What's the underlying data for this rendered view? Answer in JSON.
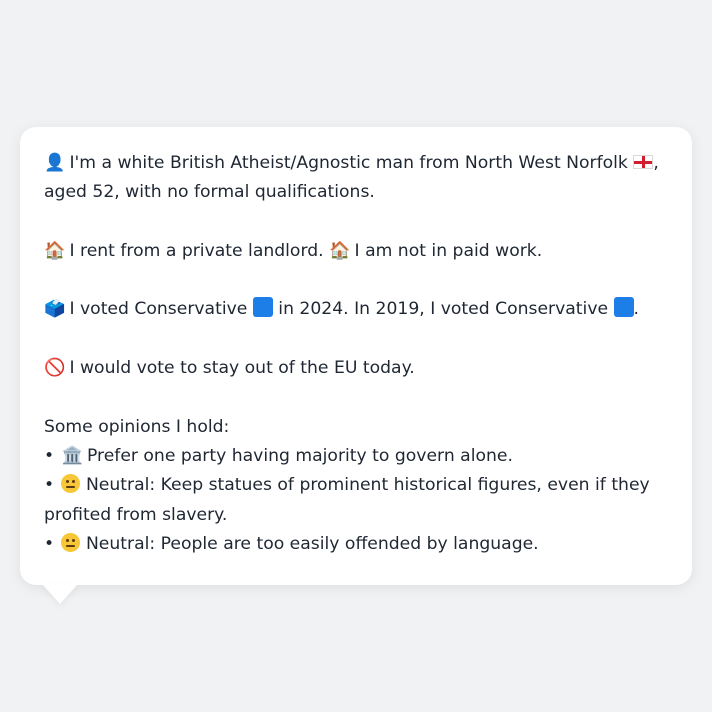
{
  "message": {
    "line1_icon": "👤",
    "line1_text": "I'm a white British Atheist/Agnostic man from North West Norfolk",
    "line1_flag_icon": "england-flag-icon",
    "line1_suffix": ",",
    "line2_text": "aged 52, with no formal qualifications.",
    "housing_icon": "🏠",
    "housing_text": "I rent from a private landlord.",
    "work_icon": "🏠",
    "work_text": "I am not in paid work.",
    "vote_icon": "🗳️",
    "vote_text_a": "I voted Conservative",
    "vote_text_b": "in 2024. In 2019, I voted Conservative",
    "vote_text_c": ".",
    "party_color": "#1e7ee8",
    "eu_icon": "🚫",
    "eu_text": "I would vote to stay out of the EU today.",
    "opinions_heading": "Some opinions I hold:",
    "bullet": "•",
    "opinion1_icon": "🏛️",
    "opinion1_text": "Prefer one party having majority to govern alone.",
    "opinion2_text_a": "Neutral: Keep statues of prominent historical figures, even if they",
    "opinion2_text_b": "profited from slavery.",
    "opinion3_text": "Neutral: People are too easily offended by language."
  }
}
